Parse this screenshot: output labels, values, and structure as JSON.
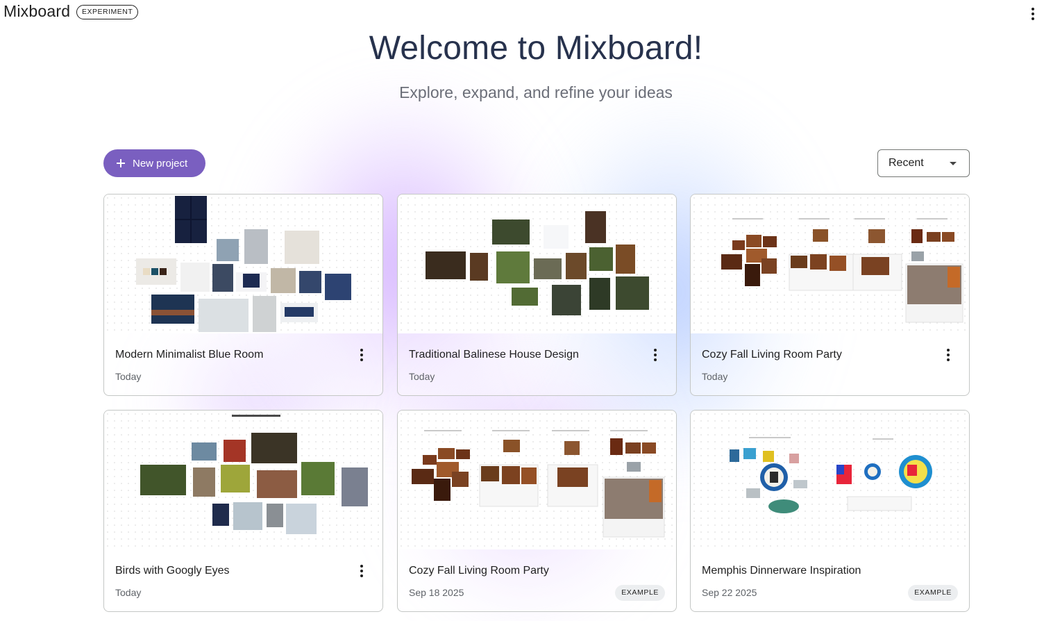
{
  "app": {
    "name": "Mixboard",
    "badge": "EXPERIMENT"
  },
  "hero": {
    "title": "Welcome to Mixboard!",
    "subtitle": "Explore, expand, and refine your ideas"
  },
  "toolbar": {
    "new_project_label": "New project",
    "sort_value": "Recent"
  },
  "colors": {
    "accent": "#7a5fc0",
    "title": "#27324d",
    "subtitle": "#6b6e78"
  },
  "icons": {
    "top_more": "more-vert-icon",
    "plus": "plus-icon",
    "dropdown": "arrow-drop-down-icon",
    "card_more": "more-vert-icon"
  },
  "projects": [
    {
      "title": "Modern Minimalist Blue Room",
      "date": "Today",
      "badge": ""
    },
    {
      "title": "Traditional Balinese House Design",
      "date": "Today",
      "badge": ""
    },
    {
      "title": "Cozy Fall Living Room Party",
      "date": "Today",
      "badge": ""
    },
    {
      "title": "Birds with Googly Eyes",
      "date": "Today",
      "badge": ""
    },
    {
      "title": "Cozy Fall Living Room Party",
      "date": "Sep 18 2025",
      "badge": "EXAMPLE"
    },
    {
      "title": "Memphis Dinnerware Inspiration",
      "date": "Sep 22 2025",
      "badge": "EXAMPLE"
    }
  ]
}
